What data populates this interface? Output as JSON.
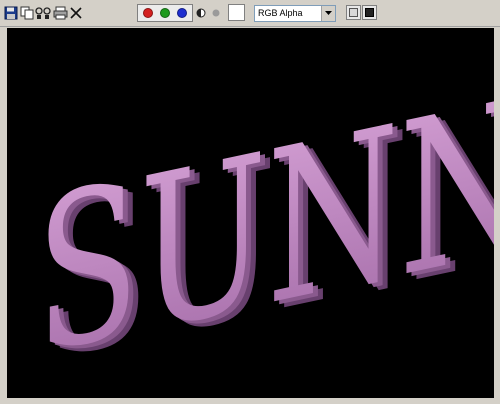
{
  "toolbar": {
    "left_tools": [
      {
        "name": "save-image",
        "icon": "floppy-disk-icon"
      },
      {
        "name": "copy-image",
        "icon": "copy-icon"
      },
      {
        "name": "clone-window",
        "icon": "clone-icon"
      },
      {
        "name": "print-image",
        "icon": "printer-icon"
      },
      {
        "name": "clear-image",
        "icon": "close-icon"
      }
    ],
    "channels": [
      {
        "name": "red",
        "color": "#d42020"
      },
      {
        "name": "green",
        "color": "#1e9a1e"
      },
      {
        "name": "blue",
        "color": "#1e2ed0"
      }
    ],
    "alpha_icon": "half-circle-icon",
    "mono_icon": "gray-dot-icon",
    "swatch_color": "#ffffff",
    "channel_select": {
      "value": "RGB Alpha"
    },
    "display_modes": [
      "display-mode-normal",
      "display-mode-dark"
    ]
  },
  "viewport": {
    "background": "#000000",
    "render_text": "SUNNY",
    "text_color": "#c08ac0",
    "text_side_color": "#8a5a8e"
  }
}
